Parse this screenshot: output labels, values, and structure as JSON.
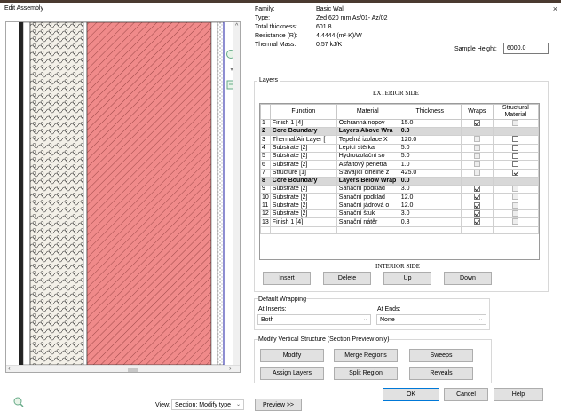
{
  "window": {
    "title": "Edit Assembly",
    "close": "×"
  },
  "properties": [
    {
      "label": "Family:",
      "value": "Basic Wall"
    },
    {
      "label": "Type:",
      "value": "Zed 620 mm As/01- Az/02"
    },
    {
      "label": "Total thickness:",
      "value": "601.8"
    },
    {
      "label": "Resistance (R):",
      "value": "4.4444 (m²·K)/W"
    },
    {
      "label": "Thermal Mass:",
      "value": "0.57 kJ/K"
    }
  ],
  "sample_height": {
    "label": "Sample Height:",
    "value": "6000.0"
  },
  "layers": {
    "group_title": "Layers",
    "exterior_label": "EXTERIOR SIDE",
    "interior_label": "INTERIOR SIDE",
    "columns": [
      "Function",
      "Material",
      "Thickness",
      "Wraps",
      "Structural Material"
    ],
    "rows": [
      {
        "num": "1",
        "function": "Finish 1 [4]",
        "material": "Ochranná nopov",
        "thickness": "15.0",
        "wraps": "checked",
        "structural": "disabled",
        "core": false
      },
      {
        "num": "2",
        "function": "Core Boundary",
        "material": "Layers Above Wra",
        "thickness": "0.0",
        "wraps": "none",
        "structural": "none",
        "core": true
      },
      {
        "num": "3",
        "function": "Thermal/Air Layer [",
        "material": "Tepelná izolace X",
        "thickness": "120.0",
        "wraps": "disabled",
        "structural": "unchecked",
        "core": false
      },
      {
        "num": "4",
        "function": "Substrate [2]",
        "material": "Lepící stěrka",
        "thickness": "5.0",
        "wraps": "disabled",
        "structural": "unchecked",
        "core": false
      },
      {
        "num": "5",
        "function": "Substrate [2]",
        "material": "Hydroizolační so",
        "thickness": "5.0",
        "wraps": "disabled",
        "structural": "unchecked",
        "core": false
      },
      {
        "num": "6",
        "function": "Substrate [2]",
        "material": "Asfaltový penetra",
        "thickness": "1.0",
        "wraps": "disabled",
        "structural": "unchecked",
        "core": false
      },
      {
        "num": "7",
        "function": "Structure [1]",
        "material": "Stávající cihelné z",
        "thickness": "425.0",
        "wraps": "disabled",
        "structural": "checked",
        "core": false
      },
      {
        "num": "8",
        "function": "Core Boundary",
        "material": "Layers Below Wrap",
        "thickness": "0.0",
        "wraps": "none",
        "structural": "none",
        "core": true
      },
      {
        "num": "9",
        "function": "Substrate [2]",
        "material": "Sanační podklad",
        "thickness": "3.0",
        "wraps": "checked",
        "structural": "disabled",
        "core": false
      },
      {
        "num": "10",
        "function": "Substrate [2]",
        "material": "Sanační podklad",
        "thickness": "12.0",
        "wraps": "checked",
        "structural": "disabled",
        "core": false
      },
      {
        "num": "11",
        "function": "Substrate [2]",
        "material": "Sanační jádrová o",
        "thickness": "12.0",
        "wraps": "checked",
        "structural": "disabled",
        "core": false
      },
      {
        "num": "12",
        "function": "Substrate [2]",
        "material": "Sanační štuk",
        "thickness": "3.0",
        "wraps": "checked",
        "structural": "disabled",
        "core": false
      },
      {
        "num": "13",
        "function": "Finish 1 [4]",
        "material": "Sanační nátěr",
        "thickness": "0.8",
        "wraps": "checked",
        "structural": "disabled",
        "core": false
      }
    ],
    "buttons": {
      "insert": "Insert",
      "delete": "Delete",
      "up": "Up",
      "down": "Down"
    }
  },
  "default_wrapping": {
    "title": "Default Wrapping",
    "at_inserts_label": "At Inserts:",
    "at_inserts_value": "Both",
    "at_ends_label": "At Ends:",
    "at_ends_value": "None"
  },
  "modify_vertical": {
    "title": "Modify Vertical Structure (Section Preview only)",
    "modify": "Modify",
    "merge_regions": "Merge Regions",
    "sweeps": "Sweeps",
    "assign_layers": "Assign Layers",
    "split_region": "Split Region",
    "reveals": "Reveals"
  },
  "footer": {
    "view_label": "View:",
    "view_value": "Section: Modify type",
    "preview_btn": "Preview >>",
    "ok": "OK",
    "cancel": "Cancel",
    "help": "Help"
  },
  "colors": {
    "masonry": "#f08a8a",
    "insulation": "#f3f0e8",
    "outline": "#333333"
  },
  "icons": [
    "zoom-icon",
    "zoom-fit-icon",
    "preview-settings-icon"
  ]
}
